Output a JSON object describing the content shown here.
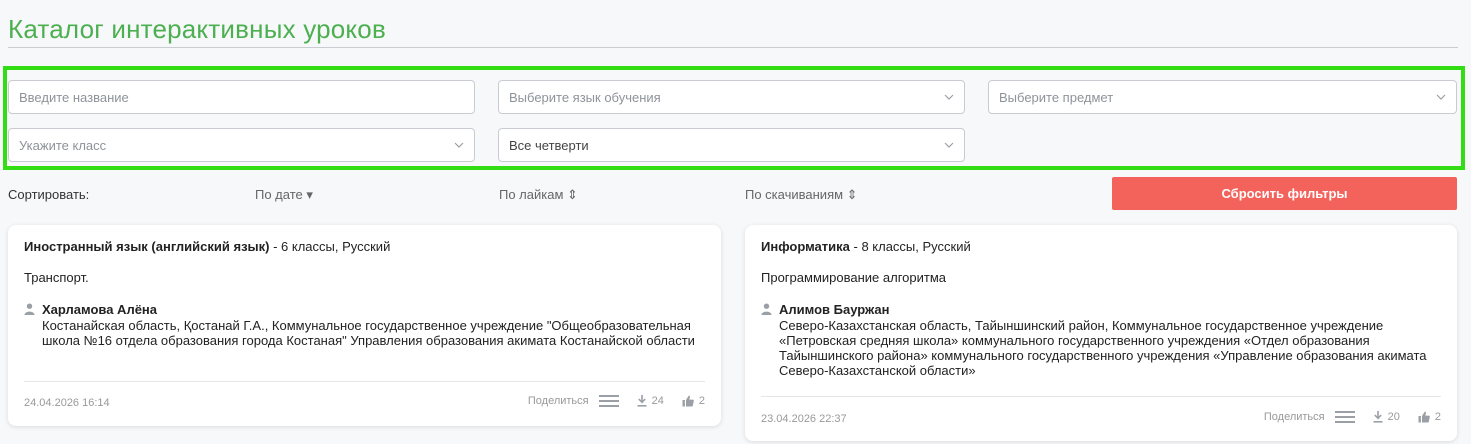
{
  "page": {
    "title": "Каталог интерактивных уроков"
  },
  "filters": {
    "name_placeholder": "Введите название",
    "language_placeholder": "Выберите язык обучения",
    "subject_placeholder": "Выберите предмет",
    "grade_placeholder": "Укажите класс",
    "quarter_value": "Все четверти"
  },
  "sort": {
    "label": "Сортировать:",
    "by_date": "По дате ▾",
    "by_likes": "По лайкам ⇕",
    "by_downloads": "По скачиваниям ⇕",
    "reset_label": "Сбросить фильтры"
  },
  "cards": [
    {
      "subject": "Иностранный язык (английский язык)",
      "details": " - 6 классы, Русский",
      "topic": "Транспорт.",
      "author": "Харламова Алёна",
      "organization": "Костанайская область, Қостанай Г.А., Коммунальное государственное учреждение \"Общеобразовательная школа №16 отдела образования города Костаная\" Управления образования акимата Костанайской области",
      "date": "24.04.2026 16:14",
      "share_label": "Поделиться",
      "downloads": "24",
      "likes": "2"
    },
    {
      "subject": "Информатика",
      "details": " - 8 классы, Русский",
      "topic": "Программирование алгоритма",
      "author": "Алимов Бауржан",
      "organization": "Северо-Казахстанская область, Тайыншинский район, Коммунальное государственное учреждение «Петровская средняя школа» коммунального государственного учреждения «Отдел образования Тайыншинского района» коммунального государственного учреждения «Управление образования акимата Северо-Казахстанской области»",
      "date": "23.04.2026 22:37",
      "share_label": "Поделиться",
      "downloads": "20",
      "likes": "2"
    }
  ],
  "colors": {
    "accent": "#4caf50",
    "reset": "#f4625c",
    "highlight": "#33dd14"
  },
  "icons": [
    "chevron-down-icon",
    "user-icon",
    "menu-icon",
    "download-icon",
    "like-icon"
  ]
}
